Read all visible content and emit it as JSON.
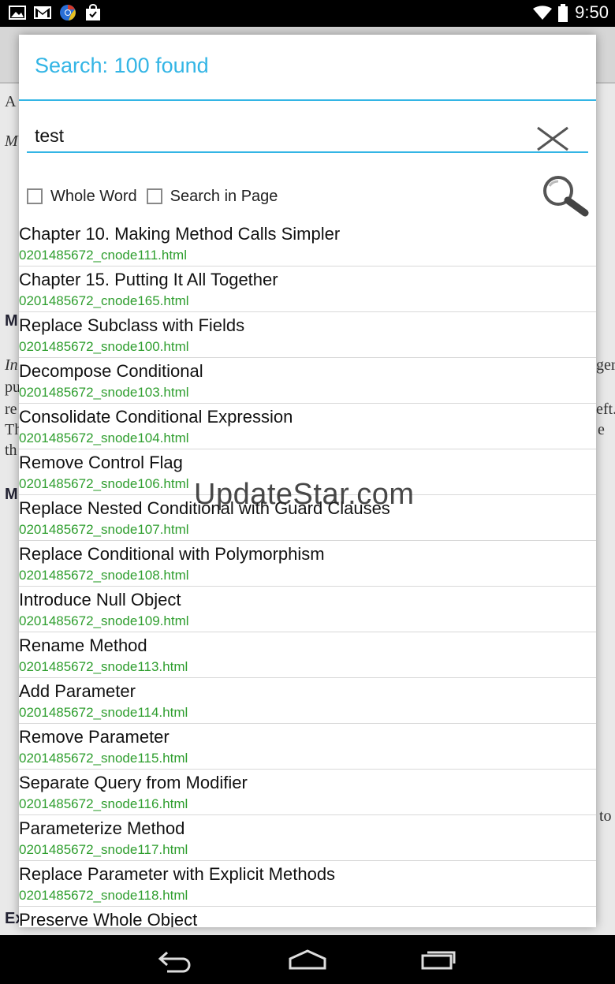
{
  "status_bar": {
    "time": "9:50",
    "left_icons": [
      "gallery-icon",
      "gmail-icon",
      "chrome-icon",
      "shopping-bag-icon"
    ],
    "right_icons": [
      "wifi-icon",
      "battery-icon"
    ]
  },
  "background": {
    "fragments": [
      "A",
      "M",
      "M",
      "In",
      "pu",
      "re",
      "Th",
      "th",
      "M",
      "ger",
      "eft.",
      "e",
      "to",
      "Ex"
    ]
  },
  "dialog": {
    "title": "Search: 100 found",
    "search": {
      "value": "test",
      "placeholder": ""
    },
    "options": {
      "whole_word_label": "Whole Word",
      "whole_word_checked": false,
      "search_in_page_label": "Search in Page",
      "search_in_page_checked": false
    },
    "results": [
      {
        "title": "Chapter 10. Making Method Calls Simpler",
        "file": "0201485672_cnode111.html"
      },
      {
        "title": "Chapter 15. Putting It All Together",
        "file": "0201485672_cnode165.html"
      },
      {
        "title": "Replace Subclass with Fields",
        "file": "0201485672_snode100.html"
      },
      {
        "title": "Decompose Conditional",
        "file": "0201485672_snode103.html"
      },
      {
        "title": "Consolidate Conditional Expression",
        "file": "0201485672_snode104.html"
      },
      {
        "title": "Remove Control Flag",
        "file": "0201485672_snode106.html"
      },
      {
        "title": "Replace Nested Conditional with Guard Clauses",
        "file": "0201485672_snode107.html"
      },
      {
        "title": "Replace Conditional with Polymorphism",
        "file": "0201485672_snode108.html"
      },
      {
        "title": "Introduce Null Object",
        "file": "0201485672_snode109.html"
      },
      {
        "title": "Rename Method",
        "file": "0201485672_snode113.html"
      },
      {
        "title": "Add Parameter",
        "file": "0201485672_snode114.html"
      },
      {
        "title": "Remove Parameter",
        "file": "0201485672_snode115.html"
      },
      {
        "title": "Separate Query from Modifier",
        "file": "0201485672_snode116.html"
      },
      {
        "title": "Parameterize Method",
        "file": "0201485672_snode117.html"
      },
      {
        "title": "Replace Parameter with Explicit Methods",
        "file": "0201485672_snode118.html"
      },
      {
        "title": "Preserve Whole Object",
        "file": ""
      }
    ]
  },
  "watermark": "UpdateStar.com",
  "nav_bar": {
    "buttons": [
      "back-icon",
      "home-icon",
      "recent-apps-icon"
    ]
  },
  "colors": {
    "accent": "#33b5e5",
    "file_green": "#2e9e2e"
  }
}
